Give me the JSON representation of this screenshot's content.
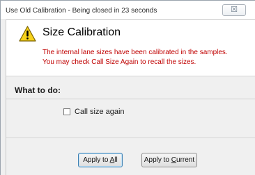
{
  "window": {
    "title": "Use Old Calibration - Being closed in 23 seconds",
    "close_symbol": "☒"
  },
  "header": {
    "icon": "warning-icon",
    "title": "Size Calibration",
    "message_line1": "The internal lane sizes have been calibrated in the samples.",
    "message_line2": "You may check Call Size Again to recall the sizes.",
    "message_color": "#c00000"
  },
  "section": {
    "label": "What to do:",
    "checkbox_label": "Call size again",
    "checkbox_checked": false
  },
  "buttons": {
    "apply_all_prefix": "Apply to ",
    "apply_all_accel": "A",
    "apply_all_suffix": "ll",
    "apply_current_prefix": "Apply to ",
    "apply_current_accel": "C",
    "apply_current_suffix": "urrent"
  }
}
